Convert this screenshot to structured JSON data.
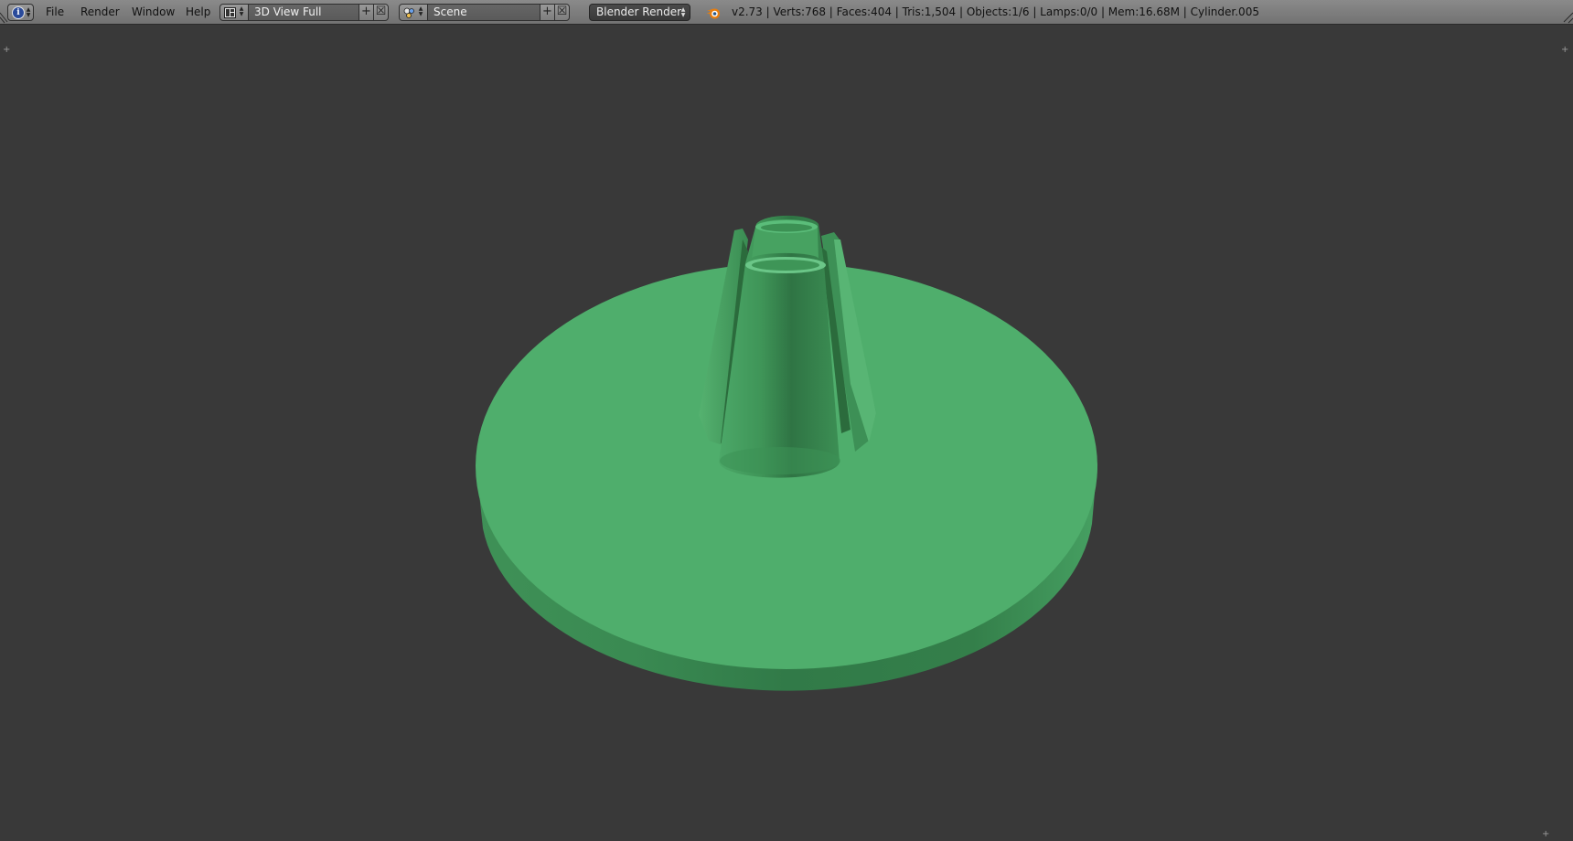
{
  "header": {
    "editor_type_icon": "info-icon",
    "menus": [
      "File",
      "Render",
      "Window",
      "Help"
    ],
    "screen_layout": {
      "icon": "screen-layout-icon",
      "value": "3D View Full"
    },
    "scene": {
      "icon": "scene-icon",
      "value": "Scene"
    },
    "render_engine": "Blender Render",
    "stats": "v2.73 | Verts:768 | Faces:404 | Tris:1,504 | Objects:1/6 | Lamps:0/0 | Mem:16.68M | Cylinder.005"
  },
  "viewport": {
    "background_color": "#393939",
    "object": "Cylinder.005",
    "object_color": "#4fae6c"
  }
}
